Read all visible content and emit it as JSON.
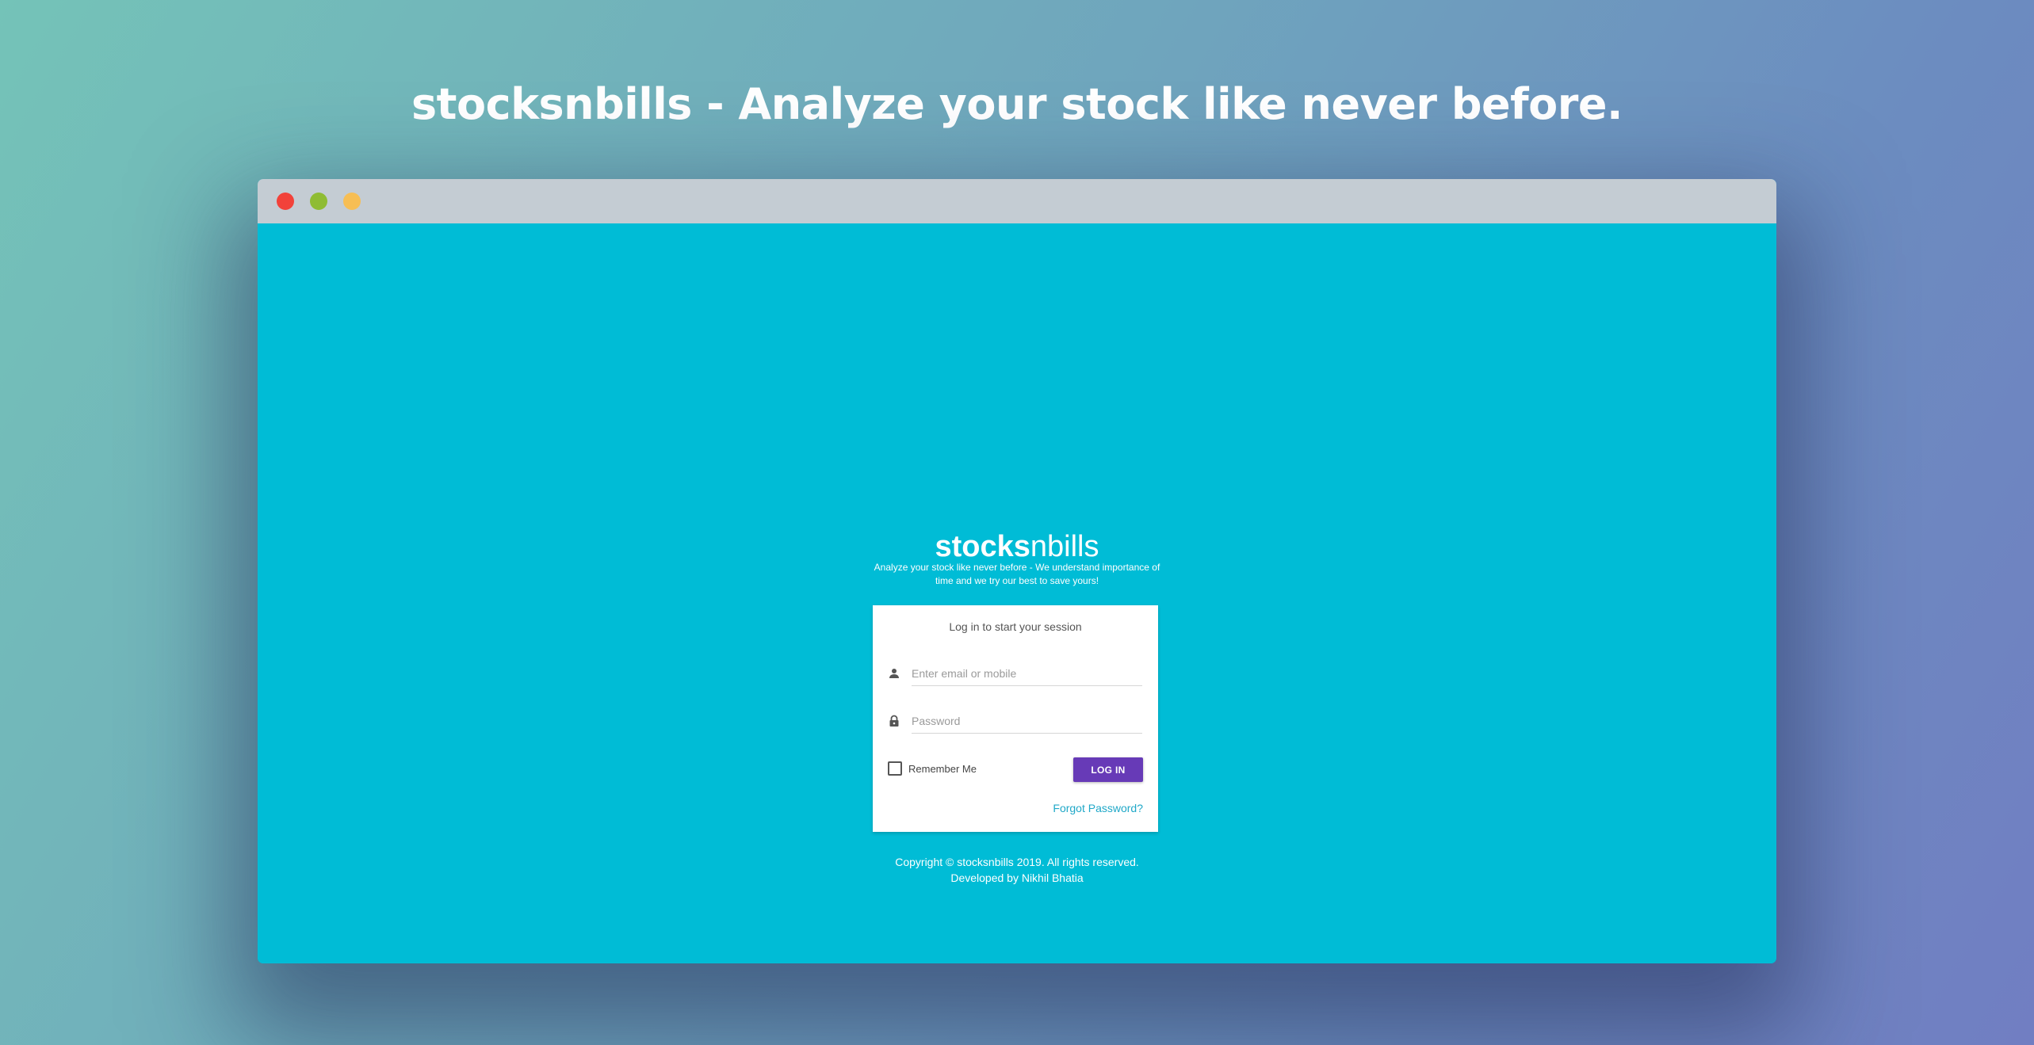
{
  "headline": "stocksnbills - Analyze your stock like never before.",
  "window": {
    "controls": [
      {
        "name": "close-dot",
        "color": "#f2423a"
      },
      {
        "name": "maximize-dot",
        "color": "#8fbc33"
      },
      {
        "name": "minimize-dot",
        "color": "#f7be54"
      }
    ]
  },
  "brand": {
    "strong": "stocks",
    "light": "nbills"
  },
  "tagline": "Analyze your stock like never before - We understand importance of time and we try our best to save yours!",
  "login": {
    "message": "Log in to start your session",
    "email_placeholder": "Enter email or mobile",
    "email_value": "",
    "password_placeholder": "Password",
    "password_value": "",
    "remember_label": "Remember Me",
    "remember_checked": false,
    "button_label": "LOG IN",
    "forgot_label": "Forgot Password?"
  },
  "footer": {
    "copyright": "Copyright © stocksnbills 2019. All rights reserved.",
    "developer": "Developed by Nikhil Bhatia"
  },
  "colors": {
    "viewport_bg": "#00bcd6",
    "button_bg": "#673ab7",
    "link": "#20a8c8",
    "titlebar": "#c4ccd3"
  },
  "icons": {
    "user": "user-icon",
    "lock": "lock-icon"
  }
}
